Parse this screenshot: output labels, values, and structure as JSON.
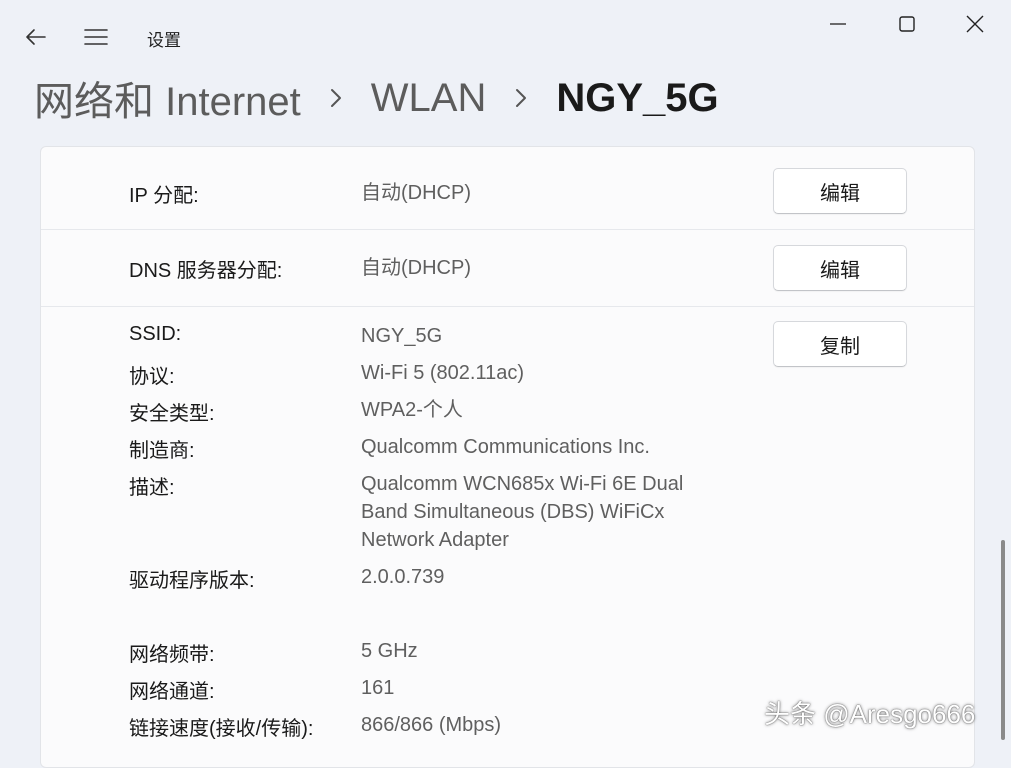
{
  "window": {
    "app_title": "设置",
    "icons": {
      "back": "back-arrow-icon",
      "menu": "hamburger-menu-icon",
      "minimize": "minimize-icon",
      "maximize": "maximize-icon",
      "close": "close-icon"
    }
  },
  "breadcrumb": {
    "items": [
      "网络和 Internet",
      "WLAN",
      "NGY_5G"
    ],
    "separator_icon": "chevron-right-icon"
  },
  "settings": {
    "ip": {
      "label": "IP 分配:",
      "value": "自动(DHCP)",
      "button": "编辑"
    },
    "dns": {
      "label": "DNS 服务器分配:",
      "value": "自动(DHCP)",
      "button": "编辑"
    },
    "props": {
      "copy_button": "复制",
      "ssid": {
        "label": "SSID:",
        "value": "NGY_5G"
      },
      "protocol": {
        "label": "协议:",
        "value": "Wi-Fi 5 (802.11ac)"
      },
      "security": {
        "label": "安全类型:",
        "value": "WPA2-个人"
      },
      "manufacturer": {
        "label": "制造商:",
        "value": "Qualcomm Communications Inc."
      },
      "description": {
        "label": "描述:",
        "lines": [
          "Qualcomm WCN685x Wi-Fi 6E Dual",
          "Band Simultaneous (DBS) WiFiCx",
          "Network Adapter"
        ]
      },
      "driver": {
        "label": "驱动程序版本:",
        "value": "2.0.0.739"
      },
      "band": {
        "label": "网络频带:",
        "value": "5 GHz"
      },
      "channel": {
        "label": "网络通道:",
        "value": "161"
      },
      "speed": {
        "label": "链接速度(接收/传输):",
        "value": "866/866 (Mbps)"
      }
    }
  },
  "watermark": "头条 @Aresgo666",
  "colors": {
    "window_bg": "#eef1f7",
    "card_bg": "#fbfbfc",
    "value_text": "#5f5f5f",
    "crumb_text": "#5c5c5c"
  }
}
